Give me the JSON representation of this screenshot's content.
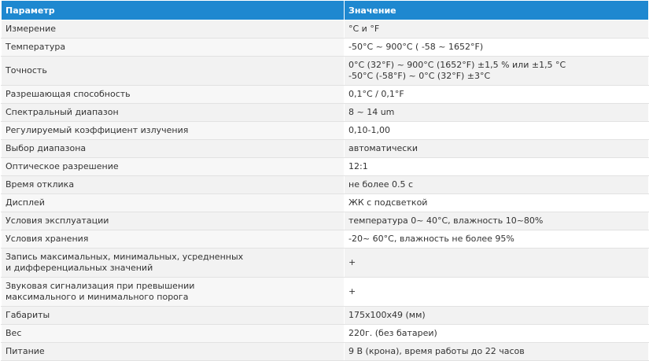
{
  "table": {
    "headers": [
      "Параметр",
      "Значение"
    ],
    "rows": [
      {
        "param": [
          "Измерение"
        ],
        "value": [
          "°C и °F"
        ]
      },
      {
        "param": [
          "Температура"
        ],
        "value": [
          "-50°C ~ 900°C ( -58 ~ 1652°F)"
        ]
      },
      {
        "param": [
          "Точность"
        ],
        "value": [
          "0°C (32°F) ~ 900°C (1652°F) ±1,5 % или ±1,5 °C",
          "-50°C (-58°F) ~ 0°C (32°F) ±3°C"
        ]
      },
      {
        "param": [
          "Разрешающая способность"
        ],
        "value": [
          "0,1°C / 0,1°F"
        ]
      },
      {
        "param": [
          "Спектральный диапазон"
        ],
        "value": [
          "8 ~ 14 um"
        ]
      },
      {
        "param": [
          "Регулируемый коэффициент излучения"
        ],
        "value": [
          "0,10-1,00"
        ]
      },
      {
        "param": [
          "Выбор диапазона"
        ],
        "value": [
          "автоматически"
        ]
      },
      {
        "param": [
          "Оптическое разрешение"
        ],
        "value": [
          "12:1"
        ]
      },
      {
        "param": [
          "Время отклика"
        ],
        "value": [
          "не более 0.5 с"
        ]
      },
      {
        "param": [
          "Дисплей"
        ],
        "value": [
          "ЖК с подсветкой"
        ]
      },
      {
        "param": [
          "Условия эксплуатации"
        ],
        "value": [
          "температура 0~ 40°C, влажность 10~80%"
        ]
      },
      {
        "param": [
          "Условия хранения"
        ],
        "value": [
          "-20~ 60°C, влажность не более 95%"
        ]
      },
      {
        "param": [
          "Запись максимальных, минимальных, усредненных",
          "и дифференциальных значений"
        ],
        "value": [
          "+"
        ]
      },
      {
        "param": [
          "Звуковая сигнализация при превышении",
          "максимального и минимального порога"
        ],
        "value": [
          "+"
        ]
      },
      {
        "param": [
          "Габариты"
        ],
        "value": [
          "175x100x49 (мм)"
        ]
      },
      {
        "param": [
          "Вес"
        ],
        "value": [
          "220г. (без батареи)"
        ]
      },
      {
        "param": [
          "Питание"
        ],
        "value": [
          "9 В (крона), время работы до 22 часов"
        ]
      }
    ]
  },
  "colors": {
    "header_bg": "#1e88d0",
    "header_text": "#ffffff",
    "row_alt_bg": "#f2f2f2"
  }
}
